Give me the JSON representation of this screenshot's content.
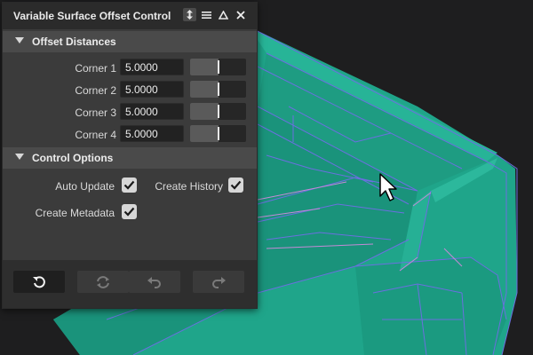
{
  "panel": {
    "title": "Variable Surface Offset Control",
    "title_icons": [
      "resize-icon",
      "menu-icon",
      "minimize-icon",
      "close-icon"
    ]
  },
  "offset_section": {
    "title": "Offset Distances",
    "rows": [
      {
        "label": "Corner 1",
        "value": "5.0000",
        "slider_level": 0.5
      },
      {
        "label": "Corner 2",
        "value": "5.0000",
        "slider_level": 0.5
      },
      {
        "label": "Corner 3",
        "value": "5.0000",
        "slider_level": 0.5
      },
      {
        "label": "Corner 4",
        "value": "5.0000",
        "slider_level": 0.5
      }
    ]
  },
  "control_section": {
    "title": "Control Options",
    "auto_update": {
      "label": "Auto Update",
      "checked": true
    },
    "create_history": {
      "label": "Create History",
      "checked": true
    },
    "create_metadata": {
      "label": "Create Metadata",
      "checked": true
    }
  },
  "actions": [
    {
      "name": "reset-icon",
      "enabled": true
    },
    {
      "name": "refresh-icon",
      "enabled": false
    },
    {
      "name": "undo-icon",
      "enabled": false
    },
    {
      "name": "redo-icon",
      "enabled": false
    }
  ],
  "colors": {
    "surface": "#1fa58a",
    "wire": "#6b6fe0",
    "wire_highlight": "#c48ad6",
    "panel_bg": "#3b3b3b",
    "section_bg": "#4a4a4a"
  }
}
